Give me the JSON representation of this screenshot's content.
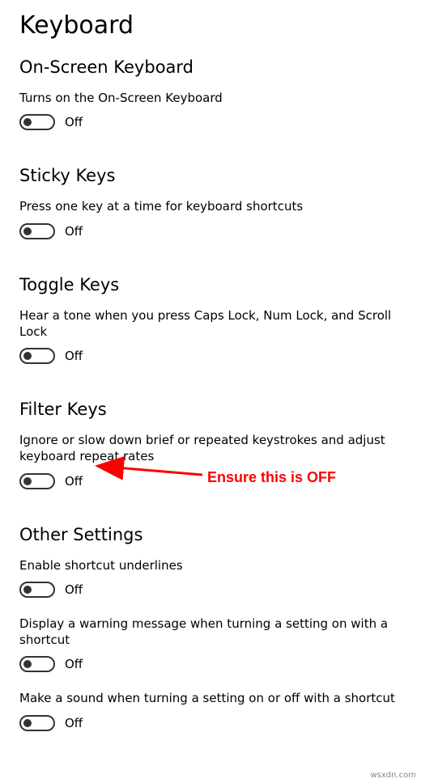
{
  "page_title": "Keyboard",
  "sections": [
    {
      "title": "On-Screen Keyboard",
      "options": [
        {
          "label": "Turns on the On-Screen Keyboard",
          "state": "Off"
        }
      ]
    },
    {
      "title": "Sticky Keys",
      "options": [
        {
          "label": "Press one key at a time for keyboard shortcuts",
          "state": "Off"
        }
      ]
    },
    {
      "title": "Toggle Keys",
      "options": [
        {
          "label": "Hear a tone when you press Caps Lock, Num Lock, and Scroll Lock",
          "state": "Off"
        }
      ]
    },
    {
      "title": "Filter Keys",
      "options": [
        {
          "label": "Ignore or slow down brief or repeated keystrokes and adjust keyboard repeat rates",
          "state": "Off"
        }
      ]
    },
    {
      "title": "Other Settings",
      "options": [
        {
          "label": "Enable shortcut underlines",
          "state": "Off"
        },
        {
          "label": "Display a warning message when turning a setting on with a shortcut",
          "state": "Off"
        },
        {
          "label": "Make a sound when turning a setting on or off with a shortcut",
          "state": "Off"
        }
      ]
    }
  ],
  "annotation_text": "Ensure this is OFF",
  "watermark": "wsxdn.com"
}
